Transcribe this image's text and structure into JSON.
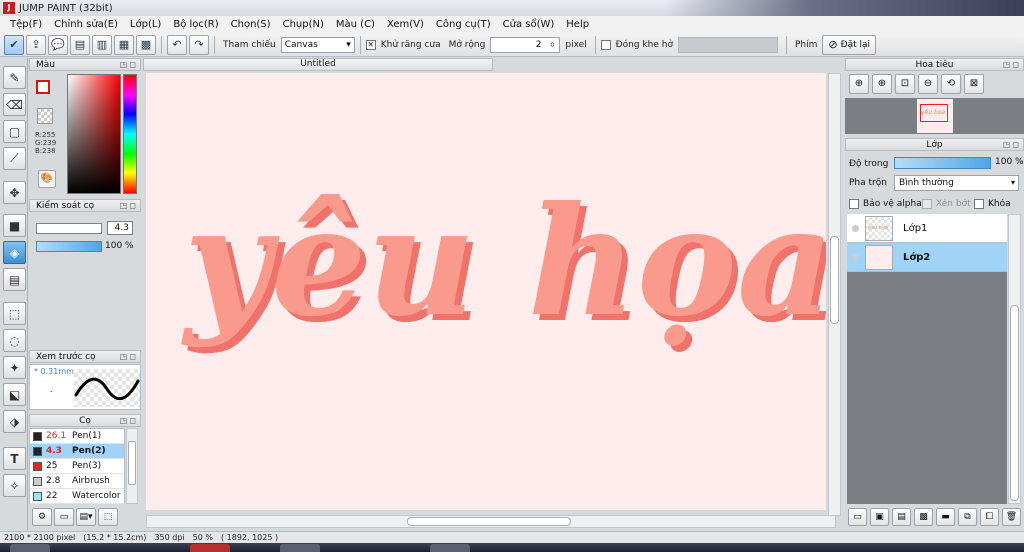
{
  "window": {
    "title": "JUMP PAINT (32bit)",
    "icon_label": "J"
  },
  "menu": [
    "Tệp(F)",
    "Chỉnh sửa(E)",
    "Lớp(L)",
    "Bộ lọc(R)",
    "Chọn(S)",
    "Chụp(N)",
    "Màu (C)",
    "Xem(V)",
    "Công cụ(T)",
    "Cửa sổ(W)",
    "Help"
  ],
  "toolbar": {
    "reference_label": "Tham chiếu",
    "reference_value": "Canvas",
    "antialias_label": "Khử răng cưa",
    "antialias_check": "✕",
    "expand_label": "Mở rộng",
    "expand_value": "2",
    "expand_unit": "pixel",
    "close_gap_label": "Đóng khe hở",
    "key_label": "Phím",
    "reset_label": "Đặt lại"
  },
  "color_panel": {
    "title": "Màu",
    "r": "R:255",
    "g": "G:239",
    "b": "B:238",
    "fg_color": "#ffffff",
    "bg_color": "#f7d95e"
  },
  "brush_control": {
    "title": "Kiểm soát cọ",
    "size_value": "4.3",
    "opacity_value": "100 %"
  },
  "brush_preview": {
    "title": "Xem trước cọ",
    "size_label": "* 0.31mm",
    "dot": "."
  },
  "brush_list": {
    "title": "Cọ",
    "items": [
      {
        "size": "26.1",
        "name": "Pen(1)",
        "color": "#222222",
        "selected": false,
        "red": true
      },
      {
        "size": "4.3",
        "name": "Pen(2)",
        "color": "#222222",
        "selected": true,
        "red": true
      },
      {
        "size": "25",
        "name": "Pen(3)",
        "color": "#e02828",
        "selected": false,
        "red": false
      },
      {
        "size": "2.8",
        "name": "Airbrush",
        "color": "#cccccc",
        "selected": false,
        "red": false
      },
      {
        "size": "22",
        "name": "Watercolor (",
        "color": "#9fe3f7",
        "selected": false,
        "red": false
      }
    ]
  },
  "document": {
    "tab_title": "Untitled",
    "canvas_color": "#ffeded",
    "lettering": "yêu họa",
    "lettering_color": "#f99a8c",
    "lettering_shadow": "#f0726a"
  },
  "navigator": {
    "title": "Hoa tiêu",
    "mini_text": "yêu họa"
  },
  "layers": {
    "title": "Lớp",
    "opacity_label": "Độ trong",
    "opacity_value": "100 %",
    "blend_label": "Pha trộn",
    "blend_value": "Bình thường",
    "protect_alpha": "Bảo vệ alpha",
    "clip": "Xén bớt",
    "lock": "Khóa",
    "items": [
      {
        "name": "Lớp1",
        "selected": false,
        "thumb": "trans"
      },
      {
        "name": "Lớp2",
        "selected": true,
        "thumb": "pink"
      }
    ]
  },
  "status": {
    "size": "2100 * 2100 pixel",
    "cm": "(15.2 * 15.2cm)",
    "dpi": "350 dpi",
    "zoom": "50 %",
    "coords": "( 1892, 1025 )"
  }
}
